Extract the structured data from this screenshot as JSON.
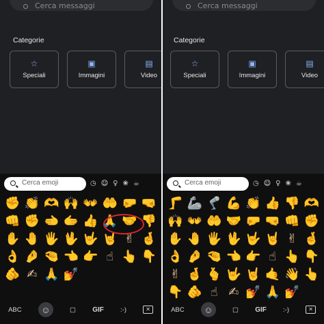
{
  "panels": [
    {
      "search_placeholder": "Cerca messaggi",
      "categories_title": "Categorie",
      "categories": [
        {
          "label": "Speciali",
          "icon": "star-icon"
        },
        {
          "label": "Immagini",
          "icon": "image-icon"
        },
        {
          "label": "Video",
          "icon": "video-icon"
        }
      ],
      "emoji_search_placeholder": "Cerca emoji",
      "emoji_category_icons": [
        "clock-icon",
        "smiley-icon",
        "person-icon",
        "animal-icon",
        "coffee-icon"
      ],
      "emojis": [
        "✊",
        "👏",
        "🫶",
        "🙌",
        "👐",
        "🤲",
        "🤛",
        "🤜",
        "👊",
        "✊",
        "🫲",
        "🫱",
        "👍",
        "🙏",
        "🤝",
        "👎",
        "✋",
        "🤚",
        "🖐",
        "🖖",
        "🤟",
        "🤘",
        "✌",
        "🤞",
        "👌",
        "🤌",
        "🤏",
        "👈",
        "👉",
        "☝",
        "👆",
        "👇",
        "🫵",
        "✍",
        "🙏",
        "💅"
      ],
      "bottom_bar": {
        "abc": "ABC",
        "gif": "GIF",
        "emoticon": ":-)"
      }
    },
    {
      "search_placeholder": "Cerca messaggi",
      "categories_title": "Categorie",
      "categories": [
        {
          "label": "Speciali",
          "icon": "star-icon"
        },
        {
          "label": "Immagini",
          "icon": "image-icon"
        },
        {
          "label": "Video",
          "icon": "video-icon"
        }
      ],
      "emoji_search_placeholder": "Cerca emoji",
      "emoji_category_icons": [
        "clock-icon",
        "smiley-icon",
        "person-icon",
        "animal-icon",
        "coffee-icon"
      ],
      "emojis": [
        "🦵",
        "🦾",
        "🦿",
        "💪",
        "👏",
        "👍",
        "👎",
        "🫶",
        "🙌",
        "👐",
        "🤲",
        "🤝",
        "🤛",
        "🤜",
        "👊",
        "✊",
        "✋",
        "🤚",
        "🖐",
        "🖖",
        "🤟",
        "🤘",
        "✌",
        "🤞",
        "👌",
        "🤌",
        "🤏",
        "👈",
        "👉",
        "☝",
        "👆",
        "👇",
        "✌",
        "🤞",
        "🫰",
        "🤟",
        "🤘",
        "🤙",
        "👋",
        "👆",
        "👇",
        "🫵",
        "☝",
        "✍",
        "💅",
        "🙏",
        "💅"
      ],
      "bottom_bar": {
        "abc": "ABC",
        "gif": "GIF",
        "emoticon": ":-)"
      }
    }
  ]
}
